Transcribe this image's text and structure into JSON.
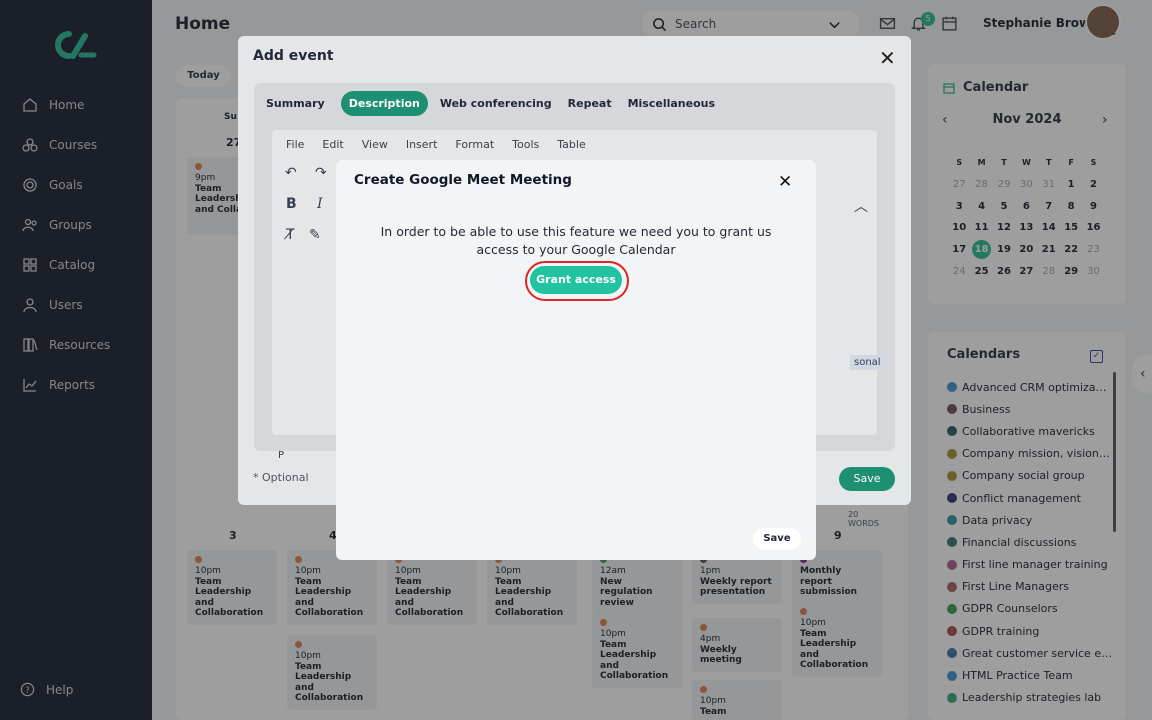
{
  "sidebar": {
    "items": [
      {
        "label": "Home",
        "icon": "home-icon"
      },
      {
        "label": "Courses",
        "icon": "courses-icon"
      },
      {
        "label": "Goals",
        "icon": "goals-icon"
      },
      {
        "label": "Groups",
        "icon": "groups-icon"
      },
      {
        "label": "Catalog",
        "icon": "catalog-icon"
      },
      {
        "label": "Users",
        "icon": "users-icon"
      },
      {
        "label": "Resources",
        "icon": "resources-icon"
      },
      {
        "label": "Reports",
        "icon": "reports-icon"
      }
    ],
    "help": "Help"
  },
  "header": {
    "title": "Home",
    "search_placeholder": "Search",
    "notification_count": "5",
    "username": "Stephanie Brown"
  },
  "calendar_view": {
    "today_label": "Today",
    "day_header": "Su",
    "week1": {
      "day_num": "27",
      "event": {
        "time": "9pm",
        "title": "Team Leadership and Collabora"
      }
    },
    "week2": {
      "days": [
        "3",
        "4",
        "9"
      ],
      "events": [
        {
          "time": "10pm",
          "title": "Team Leadership and Collaboration"
        },
        {
          "time": "10pm",
          "title": "Team Leadership and Collaboration"
        },
        {
          "time": "10pm",
          "title": "Team Leadership and Collaboration"
        },
        {
          "time": "10pm",
          "title": "Team Leadership and Collaboration"
        },
        {
          "time": "12am",
          "title": "New regulation review"
        },
        {
          "time": "1pm",
          "title": "Weekly report presentation"
        },
        {
          "time": "",
          "title": "Monthly report submission"
        },
        {
          "time": "10pm",
          "title": "Team Leadership and Collaboration"
        },
        {
          "time": "10pm",
          "title": "Team Leadership and Collaboration"
        },
        {
          "time": "4pm",
          "title": "Weekly meeting"
        },
        {
          "time": "10pm",
          "title": "Team Leadership and Collaboration"
        },
        {
          "time": "10pm",
          "title": "Team"
        }
      ]
    }
  },
  "mini_calendar": {
    "title": "Calendar",
    "month": "Nov 2024",
    "weekdays": [
      "S",
      "M",
      "T",
      "W",
      "T",
      "F",
      "S"
    ],
    "weeks": [
      [
        "27",
        "28",
        "29",
        "30",
        "31",
        "1",
        "2"
      ],
      [
        "3",
        "4",
        "5",
        "6",
        "7",
        "8",
        "9"
      ],
      [
        "10",
        "11",
        "12",
        "13",
        "14",
        "15",
        "16"
      ],
      [
        "17",
        "18",
        "19",
        "20",
        "21",
        "22",
        "23"
      ],
      [
        "24",
        "25",
        "26",
        "27",
        "28",
        "29",
        "30"
      ]
    ],
    "today": "18"
  },
  "calendars": {
    "title": "Calendars",
    "items": [
      {
        "label": "Advanced CRM optimiza…",
        "color": "#3b8fd4"
      },
      {
        "label": "Business",
        "color": "#6b4a5a"
      },
      {
        "label": "Collaborative mavericks",
        "color": "#1f5d5b"
      },
      {
        "label": "Company mission, vision…",
        "color": "#a08a2a"
      },
      {
        "label": "Company social group",
        "color": "#a3922e"
      },
      {
        "label": "Conflict management",
        "color": "#2e2a7a"
      },
      {
        "label": "Data privacy",
        "color": "#2f8f9e"
      },
      {
        "label": "Financial discussions",
        "color": "#2f6f6a"
      },
      {
        "label": "First line manager training",
        "color": "#a35a8a"
      },
      {
        "label": "First Line Managers",
        "color": "#9e5a5a"
      },
      {
        "label": "GDPR Counselors",
        "color": "#3a9a4e"
      },
      {
        "label": "GDPR training",
        "color": "#a04a4a"
      },
      {
        "label": "Great customer service e…",
        "color": "#3a6f9e"
      },
      {
        "label": "HTML Practice Team",
        "color": "#3b8fd4"
      },
      {
        "label": "Leadership strategies lab",
        "color": "#2fa66b"
      }
    ]
  },
  "add_event": {
    "title": "Add event",
    "tabs": [
      "Summary",
      "Description",
      "Web conferencing",
      "Repeat",
      "Miscellaneous"
    ],
    "active_tab": "Description",
    "editor_menu": [
      "File",
      "Edit",
      "View",
      "Insert",
      "Format",
      "Tools",
      "Table"
    ],
    "side_label": "sonal",
    "word_count": "20 WORDS",
    "path_label": "P",
    "optional_label": "* Optional",
    "save_label": "Save"
  },
  "meet_dialog": {
    "title": "Create Google Meet Meeting",
    "message_line1": "In order to be able to use this feature we need you to grant us",
    "message_line2": "access to your Google Calendar",
    "grant_label": "Grant access",
    "save_label": "Save"
  },
  "colors": {
    "sidebar_bg": "#111827",
    "accent": "#22b893",
    "grant_button": "#22c4a0",
    "highlight_ring": "#dc2626"
  }
}
